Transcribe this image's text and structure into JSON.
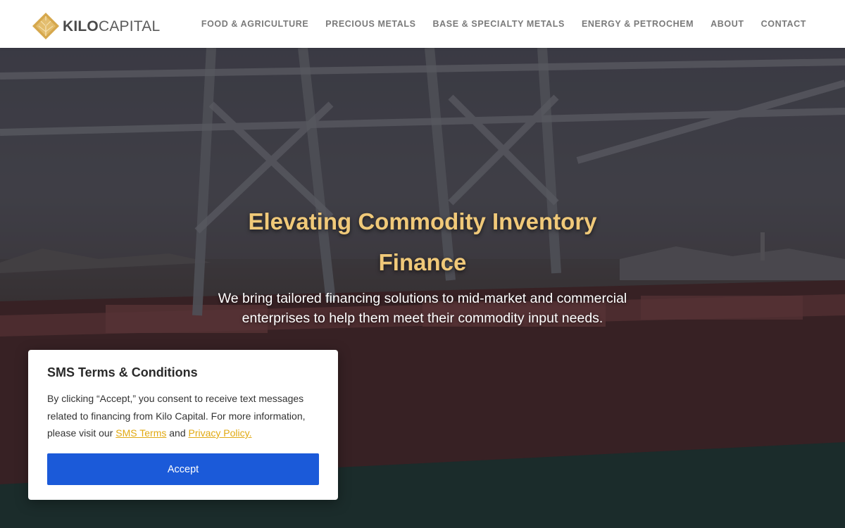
{
  "header": {
    "logo": {
      "bold": "KILO",
      "light": "CAPITAL",
      "icon": "diamond-leaf-icon",
      "color": "#d6a84d"
    },
    "nav": [
      {
        "label": "FOOD & AGRICULTURE"
      },
      {
        "label": "PRECIOUS METALS"
      },
      {
        "label": "BASE & SPECIALTY METALS"
      },
      {
        "label": "ENERGY & PETROCHEM"
      },
      {
        "label": "ABOUT"
      },
      {
        "label": "CONTACT"
      }
    ]
  },
  "hero": {
    "title": "Elevating Commodity Inventory Finance",
    "subtitle": "We bring tailored financing solutions to mid-market and commercial enterprises to help them meet their commodity input needs.",
    "title_color": "#f0c979",
    "background": "port cranes loading bulk cargo ship"
  },
  "sms_modal": {
    "title": "SMS Terms & Conditions",
    "body_prefix": "By clicking “Accept,” you consent to receive text messages related to financing from Kilo Capital. For more information, please visit our ",
    "sms_terms_link": "SMS Terms",
    "connector": " and ",
    "privacy_link": "Privacy Policy.",
    "accept_label": "Accept",
    "accent": "#1b5ad9",
    "link_color": "#e1a912"
  }
}
